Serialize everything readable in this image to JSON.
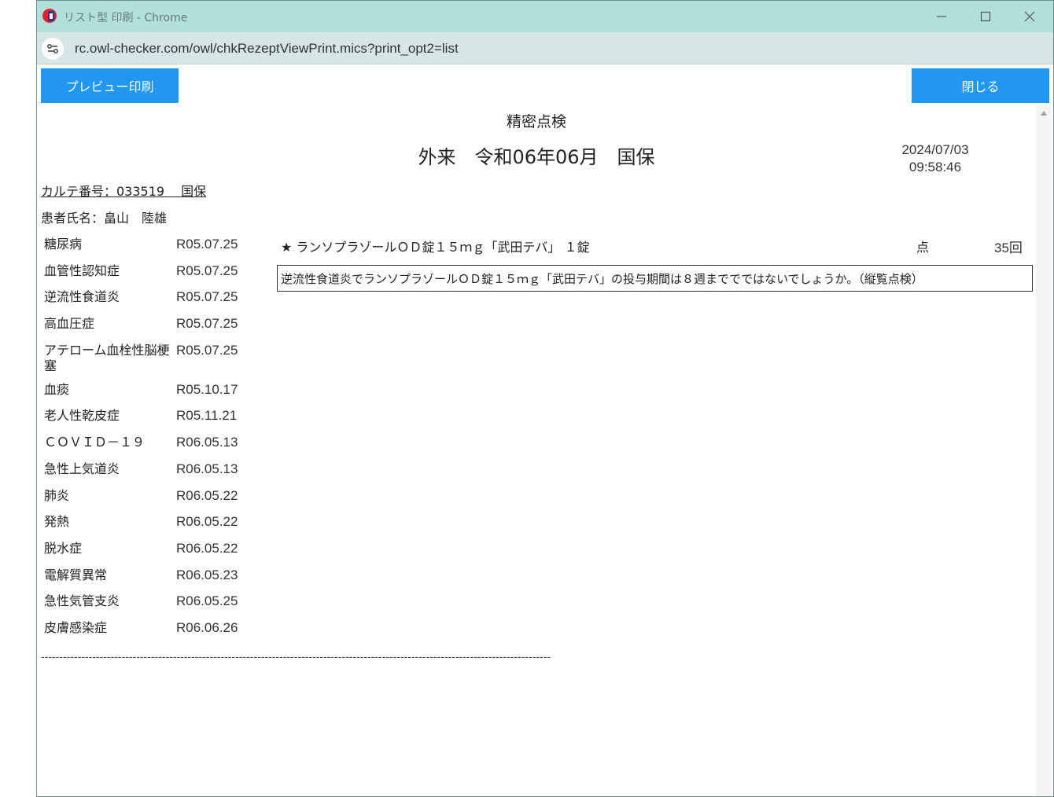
{
  "window": {
    "title": "リスト型 印刷 - Chrome",
    "url": "rc.owl-checker.com/owl/chkRezeptViewPrint.mics?print_opt2=list"
  },
  "toolbar": {
    "preview_print_label": "プレビュー印刷",
    "close_label": "閉じる"
  },
  "header": {
    "title": "精密点検",
    "subtitle": "外来　令和06年06月　国保",
    "print_date": "2024/07/03",
    "print_time": "09:58:46"
  },
  "patient": {
    "karte_label": "カルテ番号：033519　 国保",
    "name_label": "患者氏名：畠山　陸雄"
  },
  "diseases": [
    {
      "name": "糖尿病",
      "date": "R05.07.25"
    },
    {
      "name": "血管性認知症",
      "date": "R05.07.25"
    },
    {
      "name": "逆流性食道炎",
      "date": "R05.07.25"
    },
    {
      "name": "高血圧症",
      "date": "R05.07.25"
    },
    {
      "name": "アテローム血栓性脳梗塞",
      "date": "R05.07.25"
    },
    {
      "name": "血痰",
      "date": "R05.10.17"
    },
    {
      "name": "老人性乾皮症",
      "date": "R05.11.21"
    },
    {
      "name": "ＣＯＶＩＤ－１９",
      "date": "R06.05.13"
    },
    {
      "name": "急性上気道炎",
      "date": "R06.05.13"
    },
    {
      "name": "肺炎",
      "date": "R06.05.22"
    },
    {
      "name": "発熱",
      "date": "R06.05.22"
    },
    {
      "name": "脱水症",
      "date": "R06.05.22"
    },
    {
      "name": "電解質異常",
      "date": "R06.05.23"
    },
    {
      "name": "急性気管支炎",
      "date": "R06.05.25"
    },
    {
      "name": "皮膚感染症",
      "date": "R06.06.26"
    }
  ],
  "drug": {
    "name": "★ ランソプラゾールＯＤ錠１５ｍｇ「武田テバ」 １錠",
    "points": "点",
    "count": "35回"
  },
  "message": "逆流性食道炎でランソプラゾールＯＤ錠１５ｍｇ「武田テバ」の投与期間は８週まででではないでしょうか。（縦覧点検）",
  "separator": "-------------------------------------------------------------------------------------------------------------------------------------------",
  "colors": {
    "titlebar": "#b1e0dc",
    "addressbar": "#d5e6e4",
    "button": "#2196f3"
  }
}
